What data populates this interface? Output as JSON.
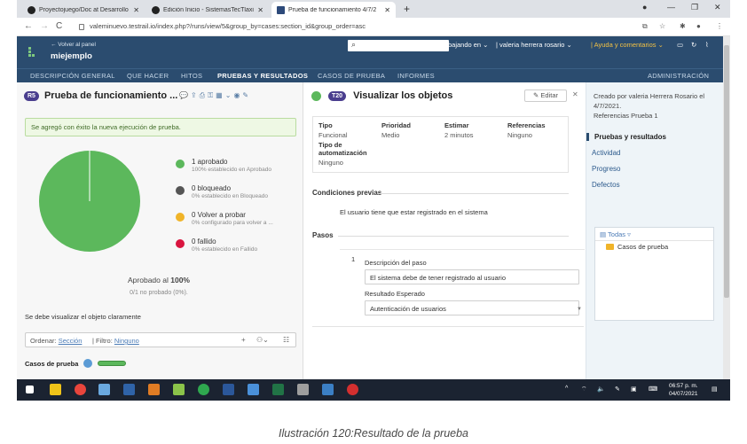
{
  "browser": {
    "tabs": [
      {
        "title": "Proyectojuego/Doc at Desarrollo",
        "active": false
      },
      {
        "title": "Edición Inicio - SistemasTecTlaxia",
        "active": false
      },
      {
        "title": "Prueba de funcionamiento 4/7/2",
        "active": true
      }
    ],
    "url": "valeminuevo.testrail.io/index.php?/runs/view/5&group_by=cases:section_id&group_order=asc"
  },
  "header": {
    "back_label": "← Volver al panel",
    "project": "miejemplo",
    "workspace": "Trabajando en",
    "user": "valeria herrera rosario",
    "help": "Ayuda y comentarios"
  },
  "nav": {
    "items": [
      "DESCRIPCIÓN GENERAL",
      "QUE HACER",
      "HITOS",
      "PRUEBAS Y RESULTADOS",
      "CASOS DE PRUEBA",
      "INFORMES"
    ],
    "active_index": 3,
    "admin": "ADMINISTRACIÓN"
  },
  "run": {
    "badge": "R5",
    "title": "Prueba de funcionamiento ...",
    "success_msg": "Se agregó con éxito la nueva ejecución de prueba.",
    "approved_prefix": "Aprobado al",
    "approved_pct": "100%",
    "not_tested": "0/1 no probado (0%).",
    "note": "Se debe visualizar el objeto claramente",
    "order_label": "Ordenar:",
    "order_value": "Sección",
    "filter_label": "Filtro:",
    "filter_value": "Ninguno",
    "cases_label": "Casos de prueba",
    "cases_count": "1"
  },
  "chart_data": {
    "type": "pie",
    "slices": [
      {
        "label": "1 aprobado",
        "detail": "100% establecido en Aprobado",
        "value": 1,
        "color": "#5cb85c"
      },
      {
        "label": "0 bloqueado",
        "detail": "0% establecido en Bloqueado",
        "value": 0,
        "color": "#555555"
      },
      {
        "label": "0 Volver a probar",
        "detail": "0% configurado para volver a ...",
        "value": 0,
        "color": "#f0b429"
      },
      {
        "label": "0 fallido",
        "detail": "0% establecido en Fallido",
        "value": 0,
        "color": "#d9153f"
      }
    ]
  },
  "test": {
    "badge": "T20",
    "title": "Visualizar los objetos",
    "edit": "Editar",
    "fields": [
      {
        "label": "Tipo",
        "value": "Funcional"
      },
      {
        "label": "Prioridad",
        "value": "Medio"
      },
      {
        "label": "Estimar",
        "value": "2 minutos"
      },
      {
        "label": "Referencias",
        "value": "Ninguno"
      },
      {
        "label": "Tipo de automatización",
        "value": "Ninguno"
      }
    ],
    "preconditions_title": "Condiciones previas",
    "preconditions": "El usuario tiene que estar registrado en el sistema",
    "steps_title": "Pasos",
    "step_number": "1",
    "step_desc_label": "Descripción del paso",
    "step_desc": "El sistema debe de tener registrado al usuario",
    "expected_label": "Resultado Esperado",
    "expected": "Autenticación de usuarios"
  },
  "sidebar": {
    "created": "Creado por valeria Herrera Rosario el 4/7/2021.",
    "refs": "Referencias Prueba 1",
    "links": [
      "Pruebas y resultados",
      "Actividad",
      "Progreso",
      "Defectos"
    ],
    "tree_header": "Todas",
    "tree_folder": "Casos de prueba"
  },
  "taskbar": {
    "time": "06:57 p. m.",
    "date": "04/07/2021"
  },
  "caption": "Ilustración 120:Resultado de la prueba"
}
